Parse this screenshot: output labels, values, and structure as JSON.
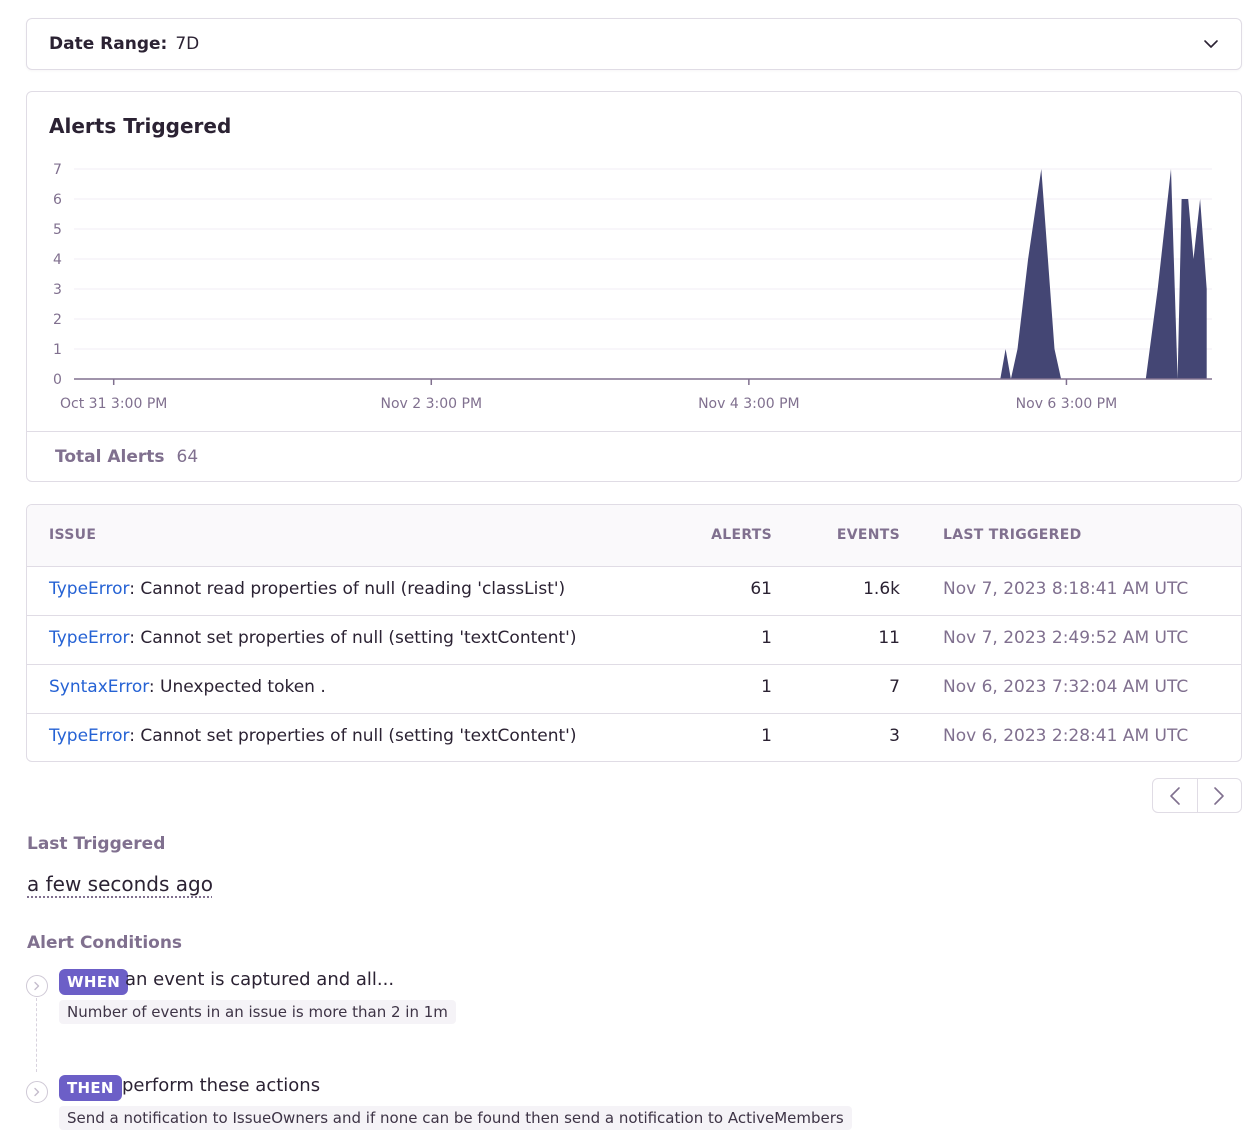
{
  "date_range": {
    "label": "Date Range:",
    "value": "7D"
  },
  "chart_card": {
    "title": "Alerts Triggered",
    "footer_label": "Total Alerts",
    "footer_value": "64"
  },
  "chart_data": {
    "type": "area",
    "title": "Alerts Triggered",
    "xlabel": "",
    "ylabel": "",
    "ylim": [
      0,
      7
    ],
    "yticks": [
      0,
      1,
      2,
      3,
      4,
      5,
      6,
      7
    ],
    "x_tick_labels": [
      "Oct 31 3:00 PM",
      "Nov 2 3:00 PM",
      "Nov 4 3:00 PM",
      "Nov 6 3:00 PM"
    ],
    "x_tick_hours": [
      0,
      48,
      96,
      144
    ],
    "x_range_hours": [
      -6,
      166
    ],
    "grid": true,
    "color": "#444674",
    "points": [
      [
        -6,
        0
      ],
      [
        134,
        0
      ],
      [
        134.8,
        1
      ],
      [
        135.6,
        0
      ],
      [
        136.6,
        1
      ],
      [
        138.2,
        4
      ],
      [
        140.2,
        7
      ],
      [
        142.2,
        1
      ],
      [
        143.2,
        0
      ],
      [
        156,
        0
      ],
      [
        157.8,
        3
      ],
      [
        159.8,
        7
      ],
      [
        160.8,
        0
      ],
      [
        161.4,
        6
      ],
      [
        162.4,
        6
      ],
      [
        163.2,
        4
      ],
      [
        164.2,
        6
      ],
      [
        165.2,
        3
      ],
      [
        165.2,
        0
      ]
    ]
  },
  "table": {
    "headers": {
      "issue": "ISSUE",
      "alerts": "ALERTS",
      "events": "EVENTS",
      "last": "LAST TRIGGERED"
    },
    "rows": [
      {
        "type": "TypeError",
        "message": ": Cannot read properties of null (reading 'classList')",
        "alerts": "61",
        "events": "1.6k",
        "last": "Nov 7, 2023 8:18:41 AM UTC"
      },
      {
        "type": "TypeError",
        "message": ": Cannot set properties of null (setting 'textContent')",
        "alerts": "1",
        "events": "11",
        "last": "Nov 7, 2023 2:49:52 AM UTC"
      },
      {
        "type": "SyntaxError",
        "message": ": Unexpected token .",
        "alerts": "1",
        "events": "7",
        "last": "Nov 6, 2023 7:32:04 AM UTC"
      },
      {
        "type": "TypeError",
        "message": ": Cannot set properties of null (setting 'textContent')",
        "alerts": "1",
        "events": "3",
        "last": "Nov 6, 2023 2:28:41 AM UTC"
      }
    ]
  },
  "last_triggered": {
    "title": "Last Triggered",
    "value": "a few seconds ago"
  },
  "conditions": {
    "title": "Alert Conditions",
    "when": {
      "badge": "WHEN",
      "text": "an event is captured and all...",
      "detail": "Number of events in an issue is more than 2 in 1m"
    },
    "then": {
      "badge": "THEN",
      "text": "perform these actions",
      "detail": "Send a notification to IssueOwners and if none can be found then send a notification to ActiveMembers"
    }
  }
}
